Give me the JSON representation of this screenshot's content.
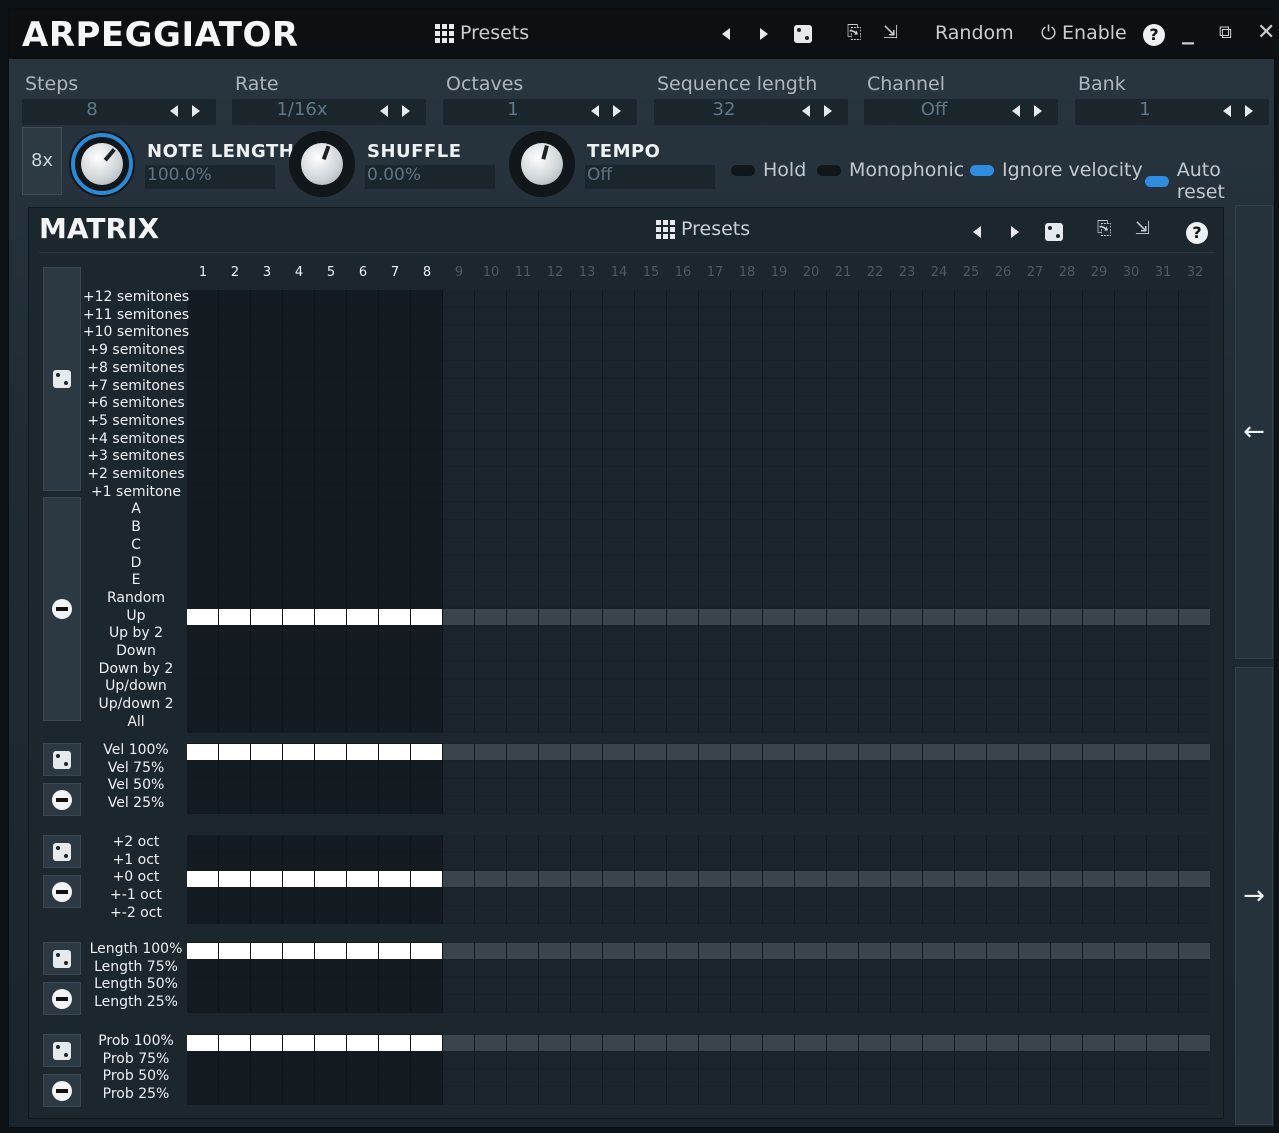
{
  "title": "ARPEGGIATOR",
  "header": {
    "presets": "Presets",
    "random": "Random",
    "enable": "Enable",
    "help": "?",
    "min": "_",
    "restore": "⧉",
    "close": "✕"
  },
  "params": [
    {
      "label": "Steps",
      "value": "8"
    },
    {
      "label": "Rate",
      "value": "1/16x"
    },
    {
      "label": "Octaves",
      "value": "1"
    },
    {
      "label": "Sequence length",
      "value": "32"
    },
    {
      "label": "Channel",
      "value": "Off"
    },
    {
      "label": "Bank",
      "value": "1"
    }
  ],
  "multiplier": "8x",
  "knobs": [
    {
      "title": "NOTE LENGTH",
      "value": "100.0%"
    },
    {
      "title": "SHUFFLE",
      "value": "0.00%"
    },
    {
      "title": "TEMPO",
      "value": "Off"
    }
  ],
  "toggles": [
    {
      "label": "Hold",
      "on": false
    },
    {
      "label": "Monophonic",
      "on": false
    },
    {
      "label": "Ignore velocity",
      "on": true
    },
    {
      "label": "Auto reset",
      "on": true
    }
  ],
  "matrix": {
    "title": "MATRIX",
    "presets": "Presets",
    "help": "?",
    "columns": [
      "1",
      "2",
      "3",
      "4",
      "5",
      "6",
      "7",
      "8",
      "9",
      "10",
      "11",
      "12",
      "13",
      "14",
      "15",
      "16",
      "17",
      "18",
      "19",
      "20",
      "21",
      "22",
      "23",
      "24",
      "25",
      "26",
      "27",
      "28",
      "29",
      "30",
      "31",
      "32"
    ],
    "active_steps": 8,
    "pitch_rows": [
      "+12 semitones",
      "+11 semitones",
      "+10 semitones",
      "+9 semitones",
      "+8 semitones",
      "+7 semitones",
      "+6 semitones",
      "+5 semitones",
      "+4 semitones",
      "+3 semitones",
      "+2 semitones",
      "+1 semitone",
      "A",
      "B",
      "C",
      "D",
      "E",
      "Random",
      "Up",
      "Up by 2",
      "Down",
      "Down by 2",
      "Up/down",
      "Up/down 2",
      "All"
    ],
    "pitch_selected": "Up",
    "velocity_rows": [
      "Vel 100%",
      "Vel 75%",
      "Vel 50%",
      "Vel 25%"
    ],
    "velocity_selected": "Vel 100%",
    "octave_rows": [
      "+2 oct",
      "+1 oct",
      "+0 oct",
      "+-1 oct",
      "+-2 oct"
    ],
    "octave_selected": "+0 oct",
    "length_rows": [
      "Length 100%",
      "Length 75%",
      "Length 50%",
      "Length 25%"
    ],
    "length_selected": "Length 100%",
    "prob_rows": [
      "Prob 100%",
      "Prob 75%",
      "Prob 50%",
      "Prob 25%"
    ],
    "prob_selected": "Prob 100%"
  },
  "colors": {
    "accent": "#2e8de0",
    "active_cell": "#ffffff",
    "inactive_cell": "#3a444b"
  }
}
